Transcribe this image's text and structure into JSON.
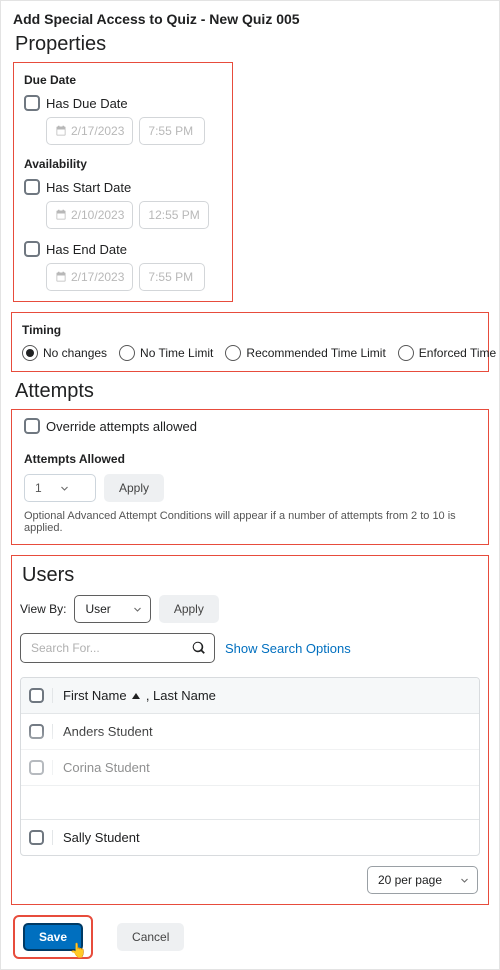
{
  "title": "Add Special Access to Quiz - New Quiz 005",
  "properties": {
    "heading": "Properties",
    "dueDate": {
      "label": "Due Date",
      "has_label": "Has Due Date",
      "date": "2/17/2023",
      "time": "7:55 PM"
    },
    "availability": {
      "label": "Availability",
      "hasStart_label": "Has Start Date",
      "start_date": "2/10/2023",
      "start_time": "12:55 PM",
      "hasEnd_label": "Has End Date",
      "end_date": "2/17/2023",
      "end_time": "7:55 PM"
    }
  },
  "timing": {
    "label": "Timing",
    "options": {
      "no_changes": "No changes",
      "no_time_limit": "No Time Limit",
      "recommended": "Recommended Time Limit",
      "enforced": "Enforced Time Limit"
    },
    "selected": "no_changes"
  },
  "attempts": {
    "heading": "Attempts",
    "override_label": "Override attempts allowed",
    "allowed_label": "Attempts Allowed",
    "value": "1",
    "apply_label": "Apply",
    "hint": "Optional Advanced Attempt Conditions will appear if a number of attempts from 2 to 10 is applied."
  },
  "users": {
    "heading": "Users",
    "viewby_label": "View By:",
    "viewby_value": "User",
    "apply_label": "Apply",
    "search_placeholder": "Search For...",
    "show_search_options": "Show Search Options",
    "table": {
      "header_first": "First Name",
      "header_last": ", Last Name",
      "rows": [
        "Anders Student",
        "Corina Student",
        "",
        "Sally Student"
      ]
    },
    "pager_label": "20 per page"
  },
  "footer": {
    "save": "Save",
    "cancel": "Cancel"
  }
}
